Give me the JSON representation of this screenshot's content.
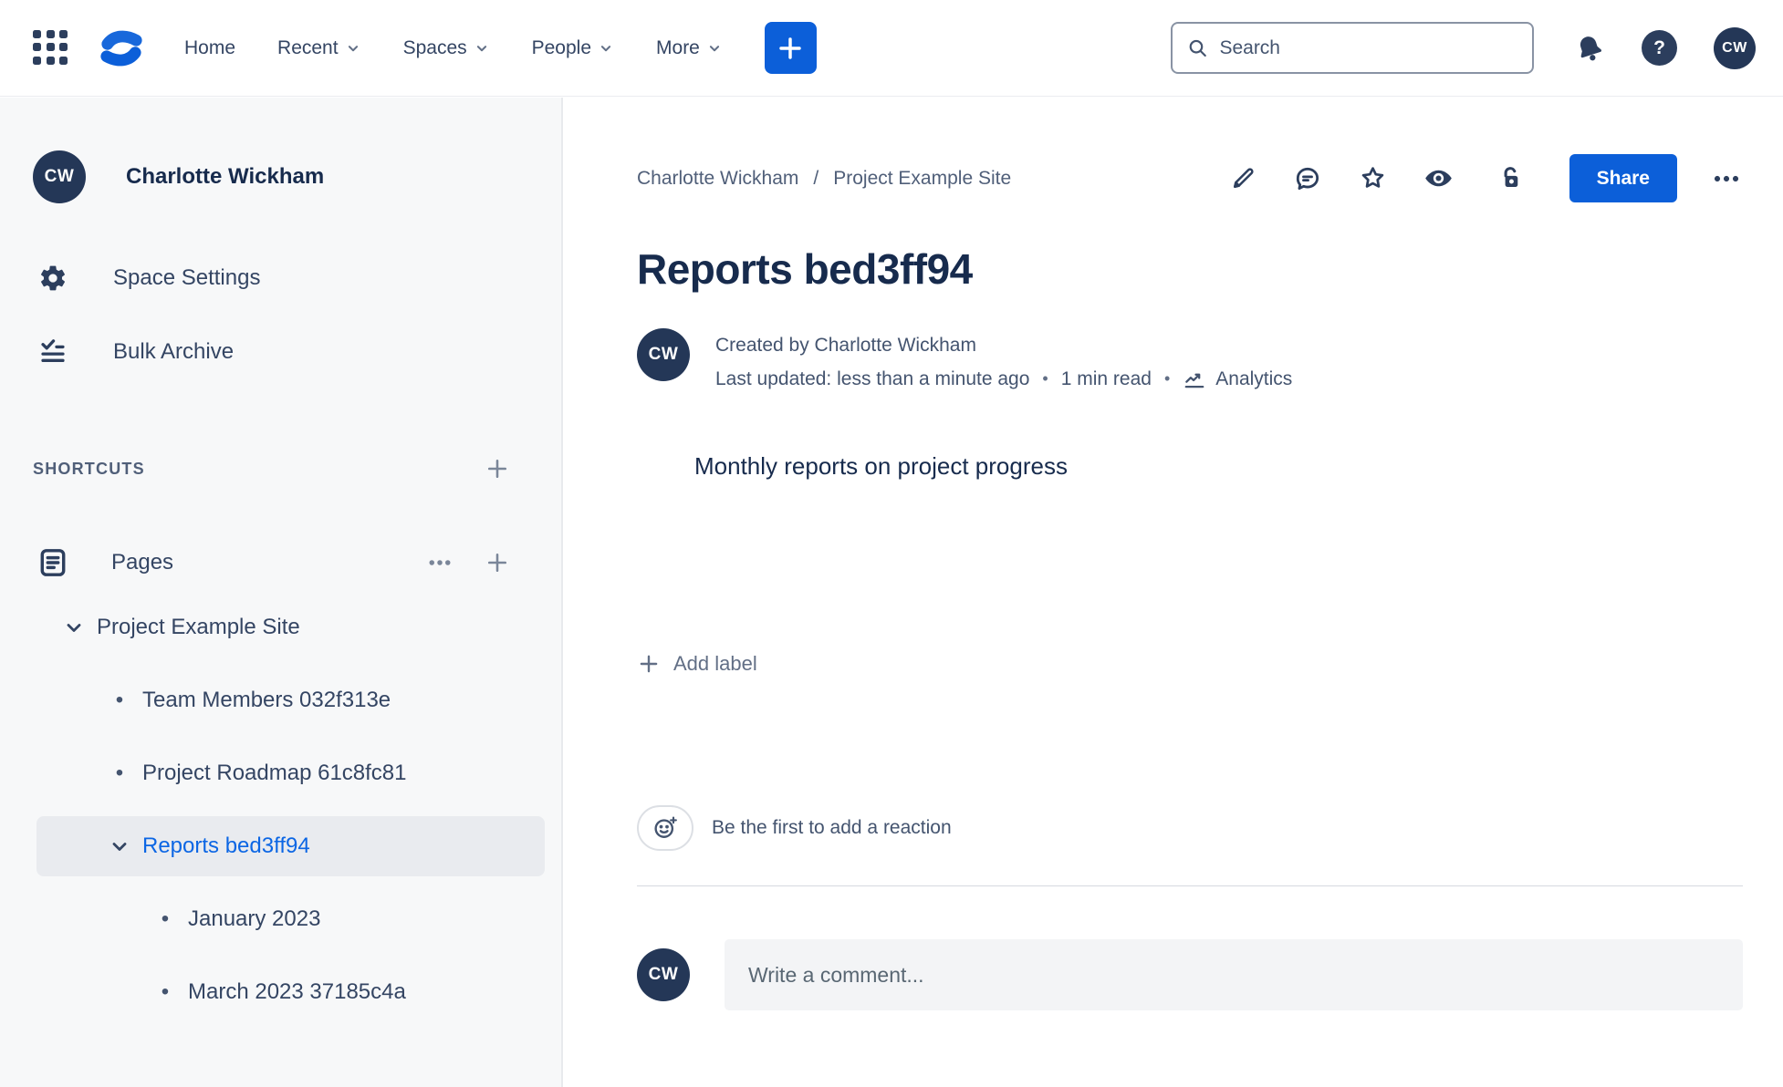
{
  "topbar": {
    "nav": [
      {
        "label": "Home",
        "dropdown": false
      },
      {
        "label": "Recent",
        "dropdown": true
      },
      {
        "label": "Spaces",
        "dropdown": true
      },
      {
        "label": "People",
        "dropdown": true
      },
      {
        "label": "More",
        "dropdown": true
      }
    ],
    "search": {
      "placeholder": "Search"
    },
    "avatar_initials": "CW",
    "icons": [
      "app-grid-icon",
      "confluence-logo",
      "plus-icon",
      "search-icon",
      "bell-icon",
      "help-icon"
    ]
  },
  "sidebar": {
    "space_name": "Charlotte Wickham",
    "space_avatar_initials": "CW",
    "items": [
      {
        "icon": "gear-icon",
        "label": "Space Settings"
      },
      {
        "icon": "bulk-archive-icon",
        "label": "Bulk Archive"
      }
    ],
    "shortcuts_label": "SHORTCUTS",
    "pages_label": "Pages",
    "tree": [
      {
        "label": "Project Example Site",
        "level": 0,
        "marker": "chevron",
        "selected": false
      },
      {
        "label": "Team Members 032f313e",
        "level": 1,
        "marker": "bullet",
        "selected": false
      },
      {
        "label": "Project Roadmap 61c8fc81",
        "level": 1,
        "marker": "bullet",
        "selected": false
      },
      {
        "label": "Reports bed3ff94",
        "level": 1,
        "marker": "chevron",
        "selected": true
      },
      {
        "label": "January 2023",
        "level": 2,
        "marker": "bullet",
        "selected": false
      },
      {
        "label": "March 2023 37185c4a",
        "level": 2,
        "marker": "bullet",
        "selected": false
      }
    ]
  },
  "content": {
    "breadcrumb": {
      "crumb1": "Charlotte Wickham",
      "separator": "/",
      "crumb2": "Project Example Site"
    },
    "action_icons": [
      "edit-pencil-icon",
      "comment-icon",
      "star-icon",
      "watch-eye-icon",
      "unlock-icon",
      "more-ellipsis-icon"
    ],
    "share_label": "Share",
    "title": "Reports bed3ff94",
    "byline": {
      "avatar_initials": "CW",
      "created": "Created by Charlotte Wickham",
      "updated": "Last updated: less than a minute ago",
      "dot": "•",
      "read_time": "1 min read",
      "analytics_label": "Analytics"
    },
    "body_text": "Monthly reports on project progress",
    "add_label": "Add label",
    "reaction_prompt": "Be the first to add a reaction",
    "comment": {
      "avatar_initials": "CW",
      "placeholder": "Write a comment..."
    }
  },
  "colors": {
    "accent_blue": "#0C5FD9",
    "link_blue": "#0C66E4",
    "avatar_navy": "#243757",
    "text_navy": "#172B4D"
  }
}
